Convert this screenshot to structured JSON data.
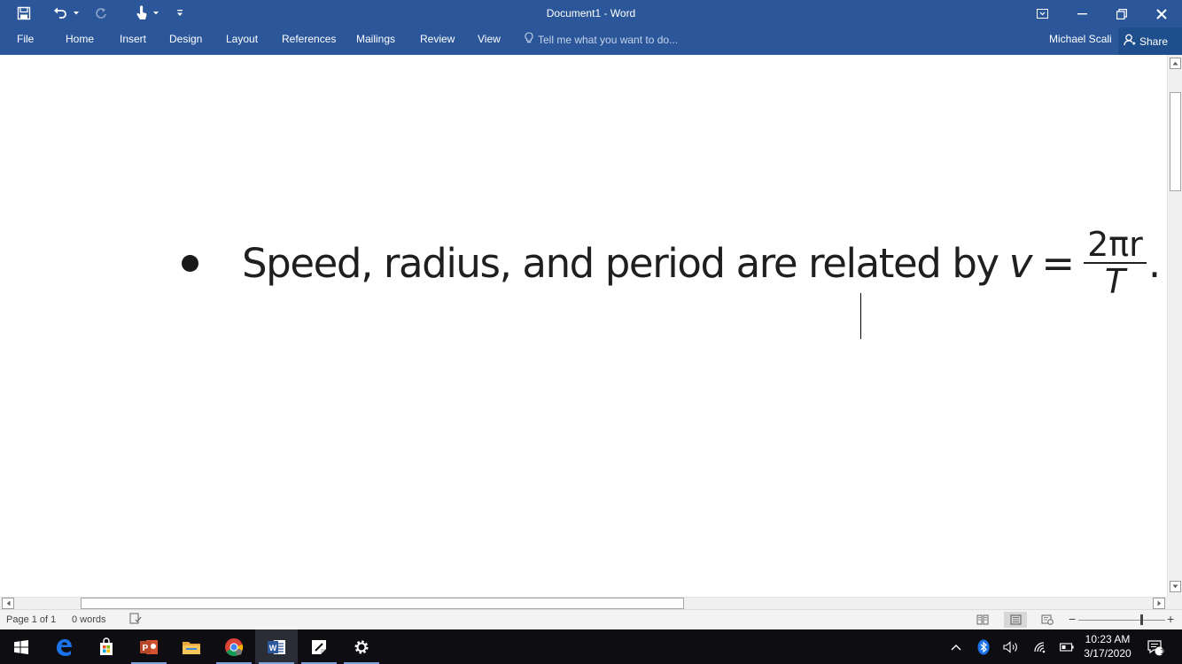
{
  "window": {
    "title": "Document1 - Word"
  },
  "ribbon": {
    "tabs": [
      "File",
      "Home",
      "Insert",
      "Design",
      "Layout",
      "References",
      "Mailings",
      "Review",
      "View"
    ],
    "tell_me_placeholder": "Tell me what you want to do...",
    "user_name": "Michael Scali",
    "share_label": "Share"
  },
  "quick_access": {
    "icons": [
      "save-icon",
      "undo-icon",
      "redo-icon",
      "touch-mode-icon",
      "customize-qat-icon"
    ]
  },
  "document": {
    "bullet_text": "Speed, radius, and period are related by",
    "equation": {
      "lhs": "v",
      "equals": "=",
      "numerator": "2πr",
      "denominator": "T",
      "trailing": "."
    }
  },
  "statusbar": {
    "page": "Page 1 of 1",
    "words": "0 words"
  },
  "taskbar": {
    "apps": [
      "windows-start-icon",
      "edge-icon",
      "store-icon",
      "powerpoint-icon",
      "file-explorer-icon",
      "chrome-icon",
      "word-icon",
      "sticky-notes-icon",
      "settings-icon"
    ],
    "time": "10:23 AM",
    "date": "3/17/2020",
    "notification_count": "1"
  },
  "colors": {
    "word_blue": "#2b579a",
    "taskbar": "#0e0e12"
  }
}
